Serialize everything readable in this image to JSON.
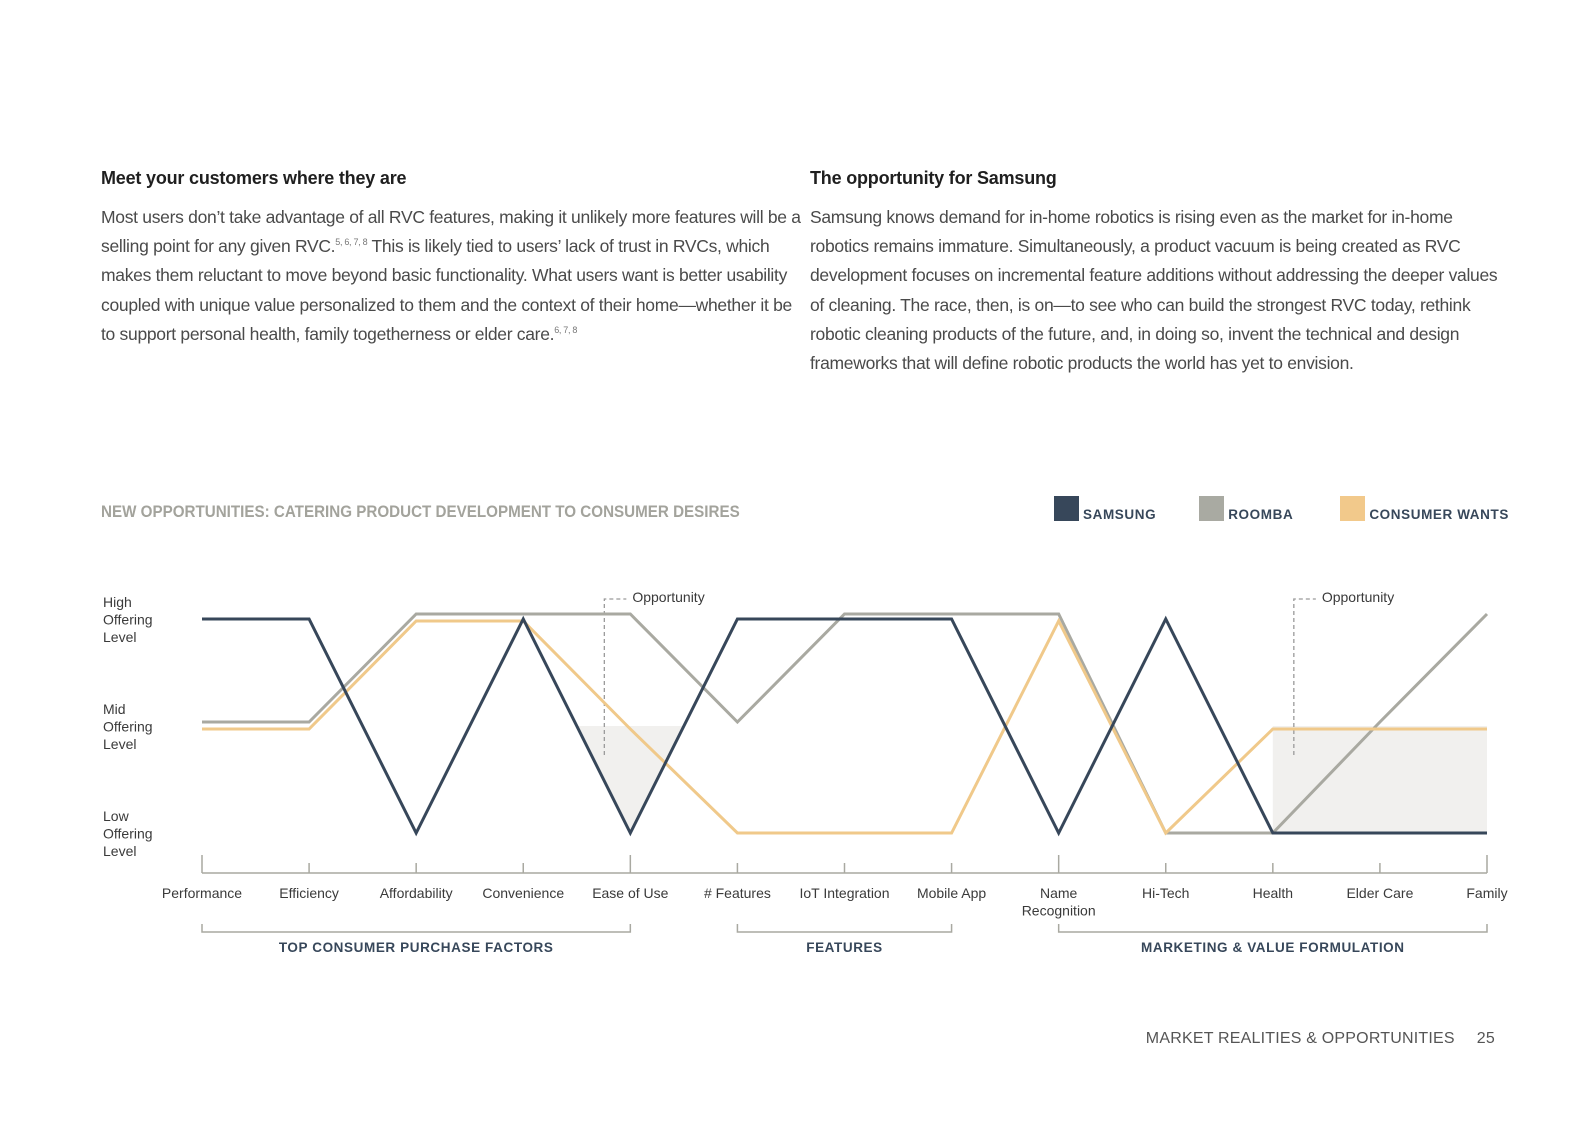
{
  "left_section": {
    "heading": "Meet your customers where they are",
    "body_parts": [
      "Most users don’t take advantage of all RVC features, making it unlikely more features will be a selling point for any given RVC.",
      "5, 6, 7, 8",
      " This is likely tied to users’ lack of trust in RVCs, which makes them reluctant to move beyond basic functionality. What users want is better usability coupled with unique value personalized to them and the context of their home—whether it be to support personal health, family togetherness or elder care.",
      "6, 7, 8"
    ]
  },
  "right_section": {
    "heading": "The opportunity for Samsung",
    "body": "Samsung knows demand for in-home robotics is rising even as the market for in-home robotics remains immature. Simultaneously, a product vacuum is being created as RVC development focuses on incremental feature additions without addressing the deeper values of cleaning. The race, then, is on—to see who can build the strongest RVC today, rethink robotic cleaning products of the future, and, in doing so, invent the technical and design frameworks that will define robotic products the world has yet to envision."
  },
  "chart_data": {
    "type": "line",
    "title": "NEW OPPORTUNITIES: CATERING PRODUCT DEVELOPMENT TO CONSUMER DESIRES",
    "xlabel": "",
    "ylabel": "Offering Level",
    "y_levels": [
      "Low\nOffering\nLevel",
      "Mid\nOffering\nLevel",
      "High\nOffering\nLevel"
    ],
    "ylim": [
      0,
      2
    ],
    "categories": [
      "Performance",
      "Efficiency",
      "Affordability",
      "Convenience",
      "Ease of Use",
      "# Features",
      "IoT Integration",
      "Mobile App",
      "Name\nRecognition",
      "Hi-Tech",
      "Health",
      "Elder Care",
      "Family"
    ],
    "series": [
      {
        "name": "SAMSUNG",
        "color": "#37475a",
        "values": [
          2,
          2,
          0,
          2,
          0,
          2,
          2,
          2,
          0,
          2,
          0,
          0,
          0
        ]
      },
      {
        "name": "ROOMBA",
        "color": "#a9a9a1",
        "values": [
          1,
          1,
          2,
          2,
          2,
          1,
          2,
          2,
          2,
          0,
          0,
          1,
          2
        ]
      },
      {
        "name": "CONSUMER WANTS",
        "color": "#f0c98a",
        "values": [
          1,
          1,
          2,
          2,
          1,
          0,
          0,
          0,
          2,
          0,
          1,
          1,
          1
        ]
      }
    ],
    "groups": [
      {
        "label": "TOP CONSUMER PURCHASE FACTORS",
        "from": "Performance",
        "to": "Ease of Use"
      },
      {
        "label": "FEATURES",
        "from": "# Features",
        "to": "Mobile App"
      },
      {
        "label": "MARKETING & VALUE FORMULATION",
        "from": "Name\nRecognition",
        "to": "Family"
      }
    ],
    "annotations": [
      {
        "text": "Opportunity",
        "near": "Ease of Use"
      },
      {
        "text": "Opportunity",
        "near": "Health"
      }
    ],
    "legend_position": "top-right",
    "grid": false
  },
  "footer": {
    "section": "MARKET REALITIES & OPPORTUNITIES",
    "page": "25"
  }
}
